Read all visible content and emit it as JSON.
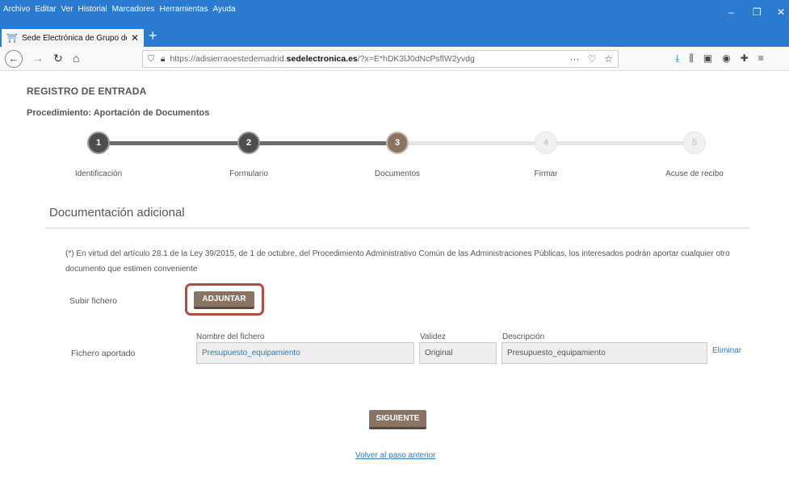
{
  "browser": {
    "menus": [
      "Archivo",
      "Editar",
      "Ver",
      "Historial",
      "Marcadores",
      "Herramientas",
      "Ayuda"
    ],
    "tab_title": "Sede Electrónica de Grupo de A",
    "url_pre": "https://adisierraoestedemadrid.",
    "url_domain": "sedelectronica.es",
    "url_post": "/?x=E*hDK3lJ0dNcPsflW2yvdg",
    "url_actions": "···"
  },
  "page": {
    "header": "REGISTRO DE ENTRADA",
    "procedure": "Procedimiento: Aportación de Documentos",
    "steps": [
      {
        "num": "1",
        "label": "Identificación"
      },
      {
        "num": "2",
        "label": "Formulario"
      },
      {
        "num": "3",
        "label": "Documentos"
      },
      {
        "num": "4",
        "label": "Firmar"
      },
      {
        "num": "5",
        "label": "Acuse de recibo"
      }
    ],
    "section_title": "Documentación adicional",
    "notice": "(*) En virtud del artículo 28.1 de la Ley 39/2015, de 1 de octubre, del Procedimiento Administrativo Común de las Administraciones Públicas, los interesados podrán aportar cualquier otro documento que estimen conveniente",
    "upload_label": "Subir fichero",
    "attach_button": "ADJUNTAR",
    "file_label": "Fichero aportado",
    "col_name": "Nombre del fichero",
    "col_validity": "Validez",
    "col_description": "Descripción",
    "file_name": "Presupuesto_equipamiento",
    "file_validity": "Original",
    "file_description": "Presupuesto_equipamiento",
    "delete_link": "Eliminar",
    "next_button": "SIGUIENTE",
    "back_link": "Volver al paso anterior"
  },
  "colors": {
    "accent": "#8b7364",
    "highlight": "#b24a4a",
    "link": "#2f7ab9"
  }
}
